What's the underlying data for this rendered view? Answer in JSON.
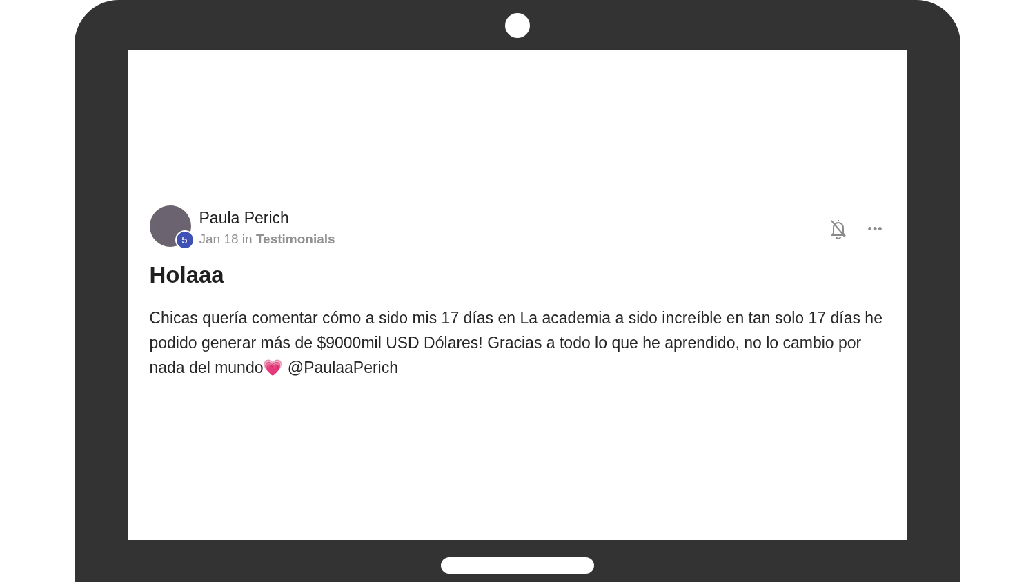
{
  "post": {
    "author": "Paula Perich",
    "level_badge": "5",
    "date": "Jan 18",
    "in_word": "in",
    "category": "Testimonials",
    "title": "Holaaa",
    "body": "Chicas quería comentar cómo a sido mis 17 días en La academia a sido increíble en tan solo 17 días he podido generar más de $9000mil USD Dólares! Gracias a todo lo que he aprendido, no lo cambio por nada del mundo💗 @PaulaaPerich",
    "more_label": "•••"
  }
}
